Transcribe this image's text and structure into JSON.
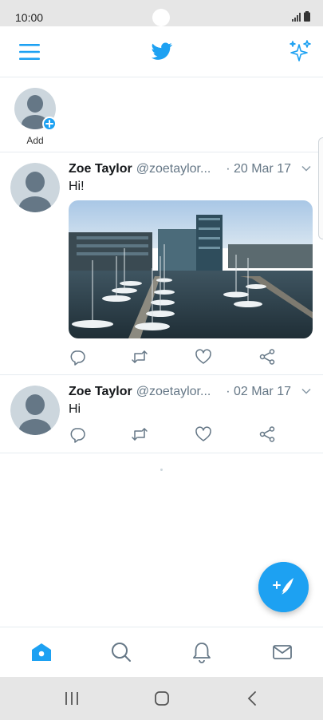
{
  "status_bar": {
    "time": "10:00"
  },
  "header": {
    "menu_icon": "hamburger-icon",
    "logo_icon": "twitter-bird-icon",
    "sparkle_icon": "sparkle-icon"
  },
  "fleets": {
    "add_label": "Add"
  },
  "tweets": [
    {
      "name": "Zoe Taylor",
      "handle": "@zoetaylor...",
      "date": "· 20 Mar 17",
      "text": "Hi!",
      "has_media": true
    },
    {
      "name": "Zoe Taylor",
      "handle": "@zoetaylor...",
      "date": "· 02 Mar 17",
      "text": "Hi",
      "has_media": false
    }
  ],
  "bottom_nav": [
    "home-icon",
    "search-icon",
    "bell-icon",
    "mail-icon"
  ],
  "colors": {
    "accent": "#1da1f2",
    "text": "#14171a",
    "muted": "#657786",
    "border": "#e6ecf0"
  }
}
